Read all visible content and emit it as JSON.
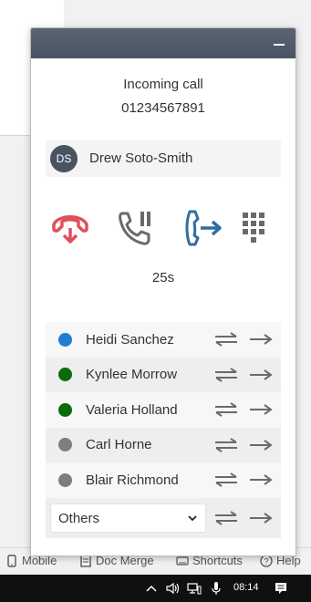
{
  "popup": {
    "call_status": "Incoming call",
    "call_number": "01234567891",
    "caller": {
      "initials": "DS",
      "name": "Drew Soto-Smith"
    },
    "timer": "25s",
    "actions": [
      "hangup-icon",
      "hold-icon",
      "transfer-call-icon",
      "dialpad-icon"
    ],
    "contacts": [
      {
        "name": "Heidi Sanchez",
        "status_color": "#1e7fd4"
      },
      {
        "name": "Kynlee Morrow",
        "status_color": "#0a6b0a"
      },
      {
        "name": "Valeria Holland",
        "status_color": "#0a6b0a"
      },
      {
        "name": "Carl Horne",
        "status_color": "#7d7d7d"
      },
      {
        "name": "Blair Richmond",
        "status_color": "#7d7d7d"
      }
    ],
    "others": {
      "selected": "Others"
    }
  },
  "footer": {
    "mobile": "Mobile",
    "doc_merge": "Doc Merge",
    "shortcuts": "Shortcuts",
    "help": "Help"
  },
  "taskbar": {
    "time": "08:14"
  },
  "colors": {
    "header": "#4d5664",
    "hangup": "#e0505a",
    "transfer": "#2f6ea3",
    "icon_gray": "#6a6a6a"
  }
}
